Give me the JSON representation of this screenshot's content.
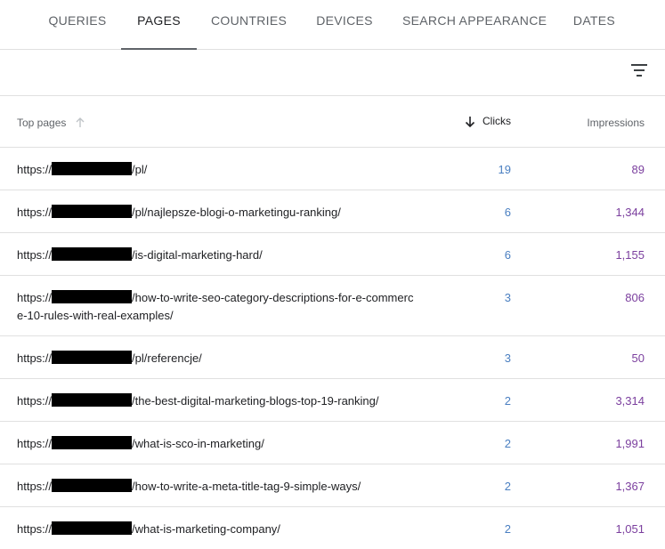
{
  "tabs": [
    {
      "label": "QUERIES",
      "active": false
    },
    {
      "label": "PAGES",
      "active": true
    },
    {
      "label": "COUNTRIES",
      "active": false
    },
    {
      "label": "DEVICES",
      "active": false
    },
    {
      "label": "SEARCH APPEARANCE",
      "active": false
    },
    {
      "label": "DATES",
      "active": false
    }
  ],
  "toolbar": {
    "filter_icon": "filter-icon"
  },
  "table": {
    "headers": {
      "pages": "Top pages",
      "clicks": "Clicks",
      "impressions": "Impressions"
    },
    "sort": {
      "column": "clicks",
      "direction": "descending"
    },
    "rows": [
      {
        "prefix": "https://",
        "suffix": "/pl/",
        "clicks": "19",
        "impressions": "89"
      },
      {
        "prefix": "https://",
        "suffix": "/pl/najlepsze-blogi-o-marketingu-ranking/",
        "clicks": "6",
        "impressions": "1,344"
      },
      {
        "prefix": "https://",
        "suffix": "/is-digital-marketing-hard/",
        "clicks": "6",
        "impressions": "1,155"
      },
      {
        "prefix": "https://",
        "suffix": "/how-to-write-seo-category-descriptions-for-e-commerce-10-rules-with-real-examples/",
        "clicks": "3",
        "impressions": "806"
      },
      {
        "prefix": "https://",
        "suffix": "/pl/referencje/",
        "clicks": "3",
        "impressions": "50"
      },
      {
        "prefix": "https://",
        "suffix": "/the-best-digital-marketing-blogs-top-19-ranking/",
        "clicks": "2",
        "impressions": "3,314"
      },
      {
        "prefix": "https://",
        "suffix": "/what-is-sco-in-marketing/",
        "clicks": "2",
        "impressions": "1,991"
      },
      {
        "prefix": "https://",
        "suffix": "/how-to-write-a-meta-title-tag-9-simple-ways/",
        "clicks": "2",
        "impressions": "1,367"
      },
      {
        "prefix": "https://",
        "suffix": "/what-is-marketing-company/",
        "clicks": "2",
        "impressions": "1,051"
      }
    ]
  },
  "colors": {
    "clicks": "#4a7fc1",
    "impressions": "#7b3f9e",
    "redaction": "#000000"
  }
}
